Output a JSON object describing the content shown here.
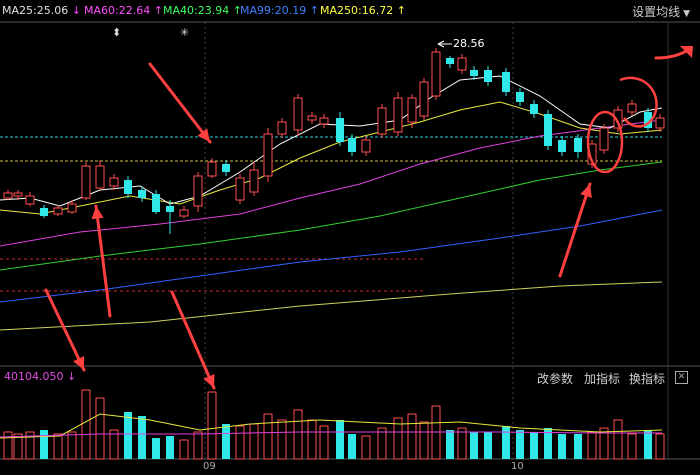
{
  "ma_legend": [
    {
      "label": "MA25:25.06",
      "arrow": "↓",
      "color": "#ffffff",
      "arrow_color": "#ff40ff"
    },
    {
      "label": "MA60:22.64",
      "arrow": "↑",
      "color": "#ff50ff",
      "arrow_color": "#ff50ff"
    },
    {
      "label": "MA40:23.94",
      "arrow": "↑",
      "color": "#40ff60",
      "arrow_color": "#40ff60"
    },
    {
      "label": "MA99:20.19",
      "arrow": "↑",
      "color": "#4080ff",
      "arrow_color": "#4080ff"
    },
    {
      "label": "MA250:16.72",
      "arrow": "↑",
      "color": "#ffff40",
      "arrow_color": "#ffff40"
    }
  ],
  "settings_label": "设置均线",
  "peak_label": "28.56",
  "event_markers": [
    "⬍",
    "✳"
  ],
  "volume": {
    "value_label": "40104.050",
    "value_arrow": "↓",
    "buttons": [
      "改参数",
      "加指标",
      "换指标"
    ],
    "close_symbol": "✕"
  },
  "x_labels": [
    "09",
    "10"
  ],
  "colors": {
    "up": "#ff5050",
    "down": "#30e8e8",
    "ma_white": "#ffffff",
    "ma_yellow": "#e8e840",
    "ma_magenta": "#e040e0",
    "ma_blue": "#3060ff",
    "ma_green": "#30d030",
    "ma_olive": "#d0d060",
    "annotation": "#ff4040"
  }
}
